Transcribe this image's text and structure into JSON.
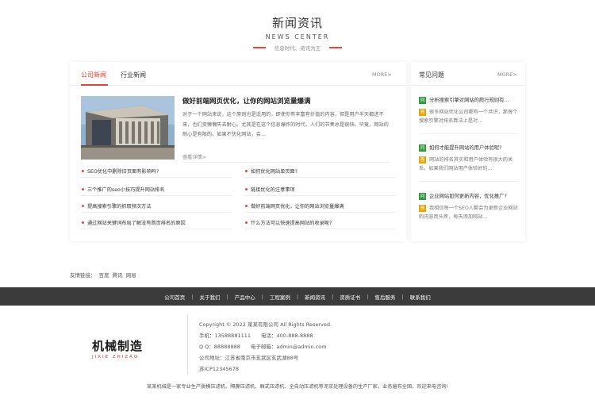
{
  "section": {
    "title": "新闻资讯",
    "subtitle": "NEWS CENTER",
    "slogan": "信息时代、资讯为王"
  },
  "news": {
    "tabs": [
      "公司新闻",
      "行业新闻"
    ],
    "more": "MORE>",
    "featured": {
      "title": "做好前端网页优化，让你的网站浏览量爆满",
      "summary": "对于一个网站来说，这个原则也是适用的，即使你有丰富有价值的内容，但是用户半天都进不来，也们变懒懒失去耐心。尤其是在这个信息爆炸的时代，人们的节奏总是很快。毕竟，网站的耐心是有限的。如果不优化网站，会…",
      "detail_link": "查看详情>"
    },
    "list_left": [
      "SEO优化中删除旧页面有影响吗?",
      "三个推广的seo小技巧提升网站排名",
      "提高搜索引擎的抓取频次方法",
      "通过网站关键词布局了解没有首页排名的原因"
    ],
    "list_right": [
      "如何优化网站单页面?",
      "链接优化的注意事项",
      "做好前端网页优化，让你的网站浏览量爆满",
      "什么方法可以快速提高网站的收录呢?"
    ]
  },
  "faq": {
    "title": "常见问题",
    "more": "MORE>",
    "q_badge": "问",
    "a_badge": "答",
    "items": [
      {
        "q": "分析搜索引擎对网站的爬行规则有...",
        "a": "很多网站优化公司都有一个共识，那每个搜索引擎对排名算法上是对..."
      },
      {
        "q": "如何才能提升网站的用户体验呢?",
        "a": "网站的排名其实和用户体验有很大的关系，如果我们网站用户体验好的..."
      },
      {
        "q": "企业网站如何更新内容，优化推广?",
        "a": "我相信每一个SEO人都会为更新企业网站的内容而头疼，每天添加网站..."
      }
    ]
  },
  "friend_links": {
    "label": "友情链接：",
    "items": [
      "百度",
      "腾讯",
      "网易"
    ]
  },
  "footer_nav": [
    "公司首页",
    "关于我们",
    "产品中心",
    "工程案例",
    "新闻资讯",
    "资质证书",
    "售后服务",
    "联系我们"
  ],
  "footer": {
    "logo_text": "机械制造",
    "logo_sub": "JIXIE ZHIZAO",
    "copyright": "Copyright © 2022 某某有限公司 All Rights Reserved.",
    "phone": "手机：13588881111　　电话：400-888-8888",
    "qq": "Q Q：88888888　　电子邮箱：admin@admin.com",
    "address": "公司地址：江苏省南京市玄武区玄武湖88号",
    "icp": "苏ICP12345678",
    "description": "某某机械是一家专业生产脱模压滤机、隔膜压滤机、厢式压滤机、全自动压滤机等泥浆处理设备的生产厂家，业务遍布全国，欢迎来电咨询!"
  }
}
